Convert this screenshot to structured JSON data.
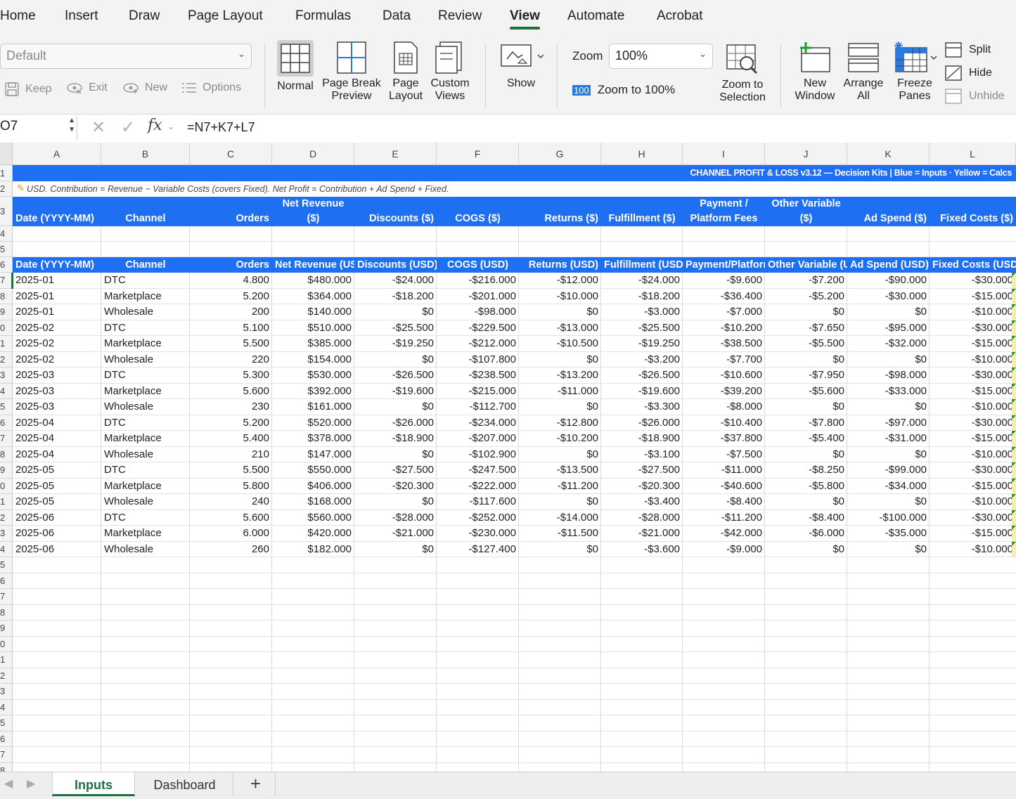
{
  "menu": {
    "tabs": [
      "Home",
      "Insert",
      "Draw",
      "Page Layout",
      "Formulas",
      "Data",
      "Review",
      "View",
      "Automate",
      "Acrobat"
    ],
    "active": "View"
  },
  "ribbon": {
    "sheet_view": {
      "value": "Default",
      "keep": "Keep",
      "exit": "Exit",
      "new": "New",
      "options": "Options"
    },
    "views": {
      "normal": "Normal",
      "page_break": "Page Break\nPreview",
      "page_layout": "Page\nLayout",
      "custom": "Custom\nViews"
    },
    "show": "Show",
    "zoom": {
      "label": "Zoom",
      "value": "100%",
      "to100": "Zoom to 100%",
      "to100_icon": "100",
      "to_selection": "Zoom to\nSelection"
    },
    "window": {
      "new": "New\nWindow",
      "arrange": "Arrange\nAll",
      "freeze": "Freeze\nPanes",
      "split": "Split",
      "hide": "Hide",
      "unhide": "Unhide"
    }
  },
  "formula_bar": {
    "cell_ref": "O7",
    "formula": "=N7+K7+L7",
    "fx": "fx"
  },
  "columns": [
    "A",
    "B",
    "C",
    "D",
    "E",
    "F",
    "G",
    "H",
    "I",
    "J",
    "K",
    "L"
  ],
  "row_numbers": [
    "1",
    "2",
    "3",
    "4",
    "5",
    "6",
    "7",
    "8",
    "9",
    "0",
    "1",
    "2",
    "3",
    "4",
    "5",
    "6",
    "7",
    "8",
    "9",
    "0",
    "1",
    "2",
    "3",
    "4",
    "5",
    "6",
    "7",
    "8",
    "9",
    "0",
    "1",
    "2",
    "3",
    "4",
    "5",
    "6",
    "7",
    "8"
  ],
  "sheet": {
    "title_banner": "CHANNEL PROFIT & LOSS v3.12 — Decision Kits  |  Blue = Inputs  ·  Yellow = Calcs",
    "note": "USD. Contribution = Revenue − Variable Costs (covers Fixed). Net Profit = Contribution + Ad Spend + Fixed.",
    "header_row3": [
      {
        "top": "",
        "bottom": "Date (YYYY-MM)"
      },
      {
        "top": "",
        "bottom": "Channel"
      },
      {
        "top": "",
        "bottom": "Orders"
      },
      {
        "top": "Net Revenue",
        "bottom": "($)"
      },
      {
        "top": "",
        "bottom": "Discounts ($)"
      },
      {
        "top": "",
        "bottom": "COGS ($)"
      },
      {
        "top": "",
        "bottom": "Returns ($)"
      },
      {
        "top": "",
        "bottom": "Fulfillment ($)"
      },
      {
        "top": "Payment /",
        "bottom": "Platform Fees"
      },
      {
        "top": "Other Variable",
        "bottom": "($)"
      },
      {
        "top": "",
        "bottom": "Ad Spend ($)"
      },
      {
        "top": "",
        "bottom": "Fixed Costs ($)"
      }
    ],
    "header_row6": [
      "Date (YYYY-MM)",
      "Channel",
      "Orders",
      "Net Revenue (USD)",
      "Discounts (USD)",
      "COGS (USD)",
      "Returns (USD)",
      "Fulfillment (USD)",
      "Payment/Platform Fees",
      "Other Variable (USD)",
      "Ad Spend (USD)",
      "Fixed Costs (USD)"
    ],
    "rows": [
      [
        "2025-01",
        "DTC",
        "4.800",
        "$480.000",
        "-$24.000",
        "-$216.000",
        "-$12.000",
        "-$24.000",
        "-$9.600",
        "-$7.200",
        "-$90.000",
        "-$30.000"
      ],
      [
        "2025-01",
        "Marketplace",
        "5.200",
        "$364.000",
        "-$18.200",
        "-$201.000",
        "-$10.000",
        "-$18.200",
        "-$36.400",
        "-$5.200",
        "-$30.000",
        "-$15.000"
      ],
      [
        "2025-01",
        "Wholesale",
        "200",
        "$140.000",
        "$0",
        "-$98.000",
        "$0",
        "-$3.000",
        "-$7.000",
        "$0",
        "$0",
        "-$10.000"
      ],
      [
        "2025-02",
        "DTC",
        "5.100",
        "$510.000",
        "-$25.500",
        "-$229.500",
        "-$13.000",
        "-$25.500",
        "-$10.200",
        "-$7.650",
        "-$95.000",
        "-$30.000"
      ],
      [
        "2025-02",
        "Marketplace",
        "5.500",
        "$385.000",
        "-$19.250",
        "-$212.000",
        "-$10.500",
        "-$19.250",
        "-$38.500",
        "-$5.500",
        "-$32.000",
        "-$15.000"
      ],
      [
        "2025-02",
        "Wholesale",
        "220",
        "$154.000",
        "$0",
        "-$107.800",
        "$0",
        "-$3.200",
        "-$7.700",
        "$0",
        "$0",
        "-$10.000"
      ],
      [
        "2025-03",
        "DTC",
        "5.300",
        "$530.000",
        "-$26.500",
        "-$238.500",
        "-$13.200",
        "-$26.500",
        "-$10.600",
        "-$7.950",
        "-$98.000",
        "-$30.000"
      ],
      [
        "2025-03",
        "Marketplace",
        "5.600",
        "$392.000",
        "-$19.600",
        "-$215.000",
        "-$11.000",
        "-$19.600",
        "-$39.200",
        "-$5.600",
        "-$33.000",
        "-$15.000"
      ],
      [
        "2025-03",
        "Wholesale",
        "230",
        "$161.000",
        "$0",
        "-$112.700",
        "$0",
        "-$3.300",
        "-$8.000",
        "$0",
        "$0",
        "-$10.000"
      ],
      [
        "2025-04",
        "DTC",
        "5.200",
        "$520.000",
        "-$26.000",
        "-$234.000",
        "-$12.800",
        "-$26.000",
        "-$10.400",
        "-$7.800",
        "-$97.000",
        "-$30.000"
      ],
      [
        "2025-04",
        "Marketplace",
        "5.400",
        "$378.000",
        "-$18.900",
        "-$207.000",
        "-$10.200",
        "-$18.900",
        "-$37.800",
        "-$5.400",
        "-$31.000",
        "-$15.000"
      ],
      [
        "2025-04",
        "Wholesale",
        "210",
        "$147.000",
        "$0",
        "-$102.900",
        "$0",
        "-$3.100",
        "-$7.500",
        "$0",
        "$0",
        "-$10.000"
      ],
      [
        "2025-05",
        "DTC",
        "5.500",
        "$550.000",
        "-$27.500",
        "-$247.500",
        "-$13.500",
        "-$27.500",
        "-$11.000",
        "-$8.250",
        "-$99.000",
        "-$30.000"
      ],
      [
        "2025-05",
        "Marketplace",
        "5.800",
        "$406.000",
        "-$20.300",
        "-$222.000",
        "-$11.200",
        "-$20.300",
        "-$40.600",
        "-$5.800",
        "-$34.000",
        "-$15.000"
      ],
      [
        "2025-05",
        "Wholesale",
        "240",
        "$168.000",
        "$0",
        "-$117.600",
        "$0",
        "-$3.400",
        "-$8.400",
        "$0",
        "$0",
        "-$10.000"
      ],
      [
        "2025-06",
        "DTC",
        "5.600",
        "$560.000",
        "-$28.000",
        "-$252.000",
        "-$14.000",
        "-$28.000",
        "-$11.200",
        "-$8.400",
        "-$100.000",
        "-$30.000"
      ],
      [
        "2025-06",
        "Marketplace",
        "6.000",
        "$420.000",
        "-$21.000",
        "-$230.000",
        "-$11.500",
        "-$21.000",
        "-$42.000",
        "-$6.000",
        "-$35.000",
        "-$15.000"
      ],
      [
        "2025-06",
        "Wholesale",
        "260",
        "$182.000",
        "$0",
        "-$127.400",
        "$0",
        "-$3.600",
        "-$9.000",
        "$0",
        "$0",
        "-$10.000"
      ]
    ]
  },
  "sheet_tabs": {
    "tabs": [
      "Inputs",
      "Dashboard"
    ],
    "active": "Inputs",
    "add": "+"
  },
  "colors": {
    "accent_green": "#1e7145",
    "header_blue": "#1f6ff2",
    "calc_yellow": "#fbef9c"
  }
}
